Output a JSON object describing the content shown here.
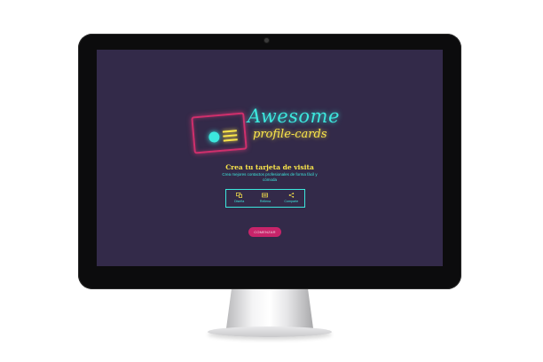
{
  "logo": {
    "word1": "Awesome",
    "word2": "profile-cards"
  },
  "hero": {
    "heading": "Crea tu tarjeta de visita",
    "subtitle": "Crea mejores contactos profesionales de forma fácil y cómoda"
  },
  "features": [
    {
      "label": "Diseña",
      "icon": "layout-icon"
    },
    {
      "label": "Rellena",
      "icon": "keyboard-icon"
    },
    {
      "label": "Comparte",
      "icon": "share-icon"
    }
  ],
  "cta": {
    "label": "COMENZAR"
  },
  "colors": {
    "background": "#332a49",
    "cyan": "#3ce7dd",
    "yellow": "#fbe64a",
    "pink": "#c8246a"
  }
}
